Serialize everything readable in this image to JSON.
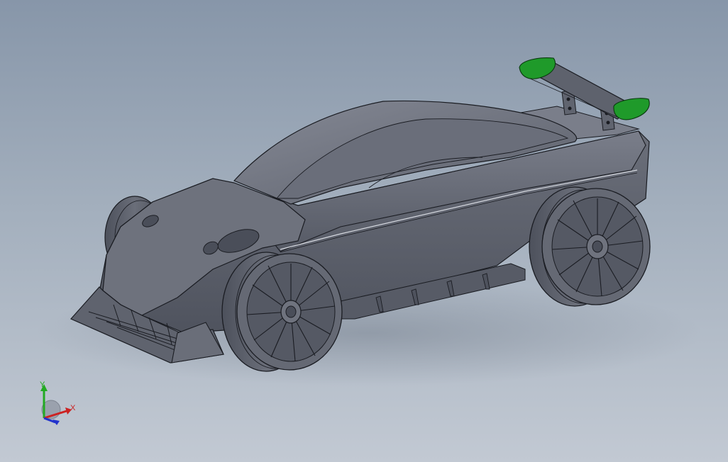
{
  "viewport": {
    "background_top": "#8796a9",
    "background_bottom": "#c2c9d3"
  },
  "model": {
    "body_color": "#666a76",
    "body_light": "#7b7f8b",
    "body_dark": "#4d515c",
    "edge_color": "#1a1c22",
    "wing_endplate_color": "#1f9a2a",
    "wheel_rim_color": "#5a5e6a",
    "tire_color": "#595d69"
  },
  "triad": {
    "y_label": "Y",
    "x_label": "X",
    "y_color": "#22aa22",
    "x_color": "#cc2222",
    "z_color": "#2233cc"
  }
}
